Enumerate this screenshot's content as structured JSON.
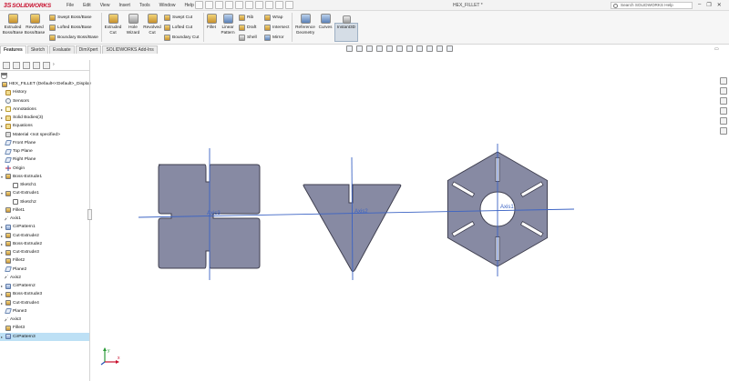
{
  "app": {
    "brand": "SOLIDWORKS",
    "brand_mark": "3S"
  },
  "menu": [
    "File",
    "Edit",
    "View",
    "Insert",
    "Tools",
    "Window",
    "Help"
  ],
  "document_title": "HEX_FILLET *",
  "search_placeholder": "Search SOLIDWORKS Help",
  "window_controls": {
    "minimize": "–",
    "restore": "❐",
    "close": "✕"
  },
  "ribbon": {
    "extruded_boss": "Extruded\nBoss/Base",
    "revolved_boss": "Revolved\nBoss/Base",
    "swept_boss": "Swept Boss/Base",
    "lofted_boss": "Lofted Boss/Base",
    "boundary_boss": "Boundary Boss/Base",
    "extruded_cut": "Extruded\nCut",
    "hole_wizard": "Hole\nWizard",
    "revolved_cut": "Revolved\nCut",
    "swept_cut": "Swept Cut",
    "lofted_cut": "Lofted Cut",
    "boundary_cut": "Boundary Cut",
    "fillet": "Fillet",
    "linear_pattern": "Linear\nPattern",
    "rib": "Rib",
    "draft": "Draft",
    "shell": "Shell",
    "wrap": "Wrap",
    "intersect": "Intersect",
    "mirror": "Mirror",
    "reference_geometry": "Reference\nGeometry",
    "curves": "Curves",
    "instant3d": "Instant3D"
  },
  "tabs": [
    "Features",
    "Sketch",
    "Evaluate",
    "DimXpert",
    "SOLIDWORKS Add-Ins"
  ],
  "tree": {
    "root": "HEX_FILLET  (Default<<Default>_Display",
    "items": [
      {
        "label": "History",
        "icon": "folder-icon",
        "kind": "folder",
        "expand": ""
      },
      {
        "label": "Sensors",
        "icon": "sensor-icon",
        "kind": "sensor",
        "expand": ""
      },
      {
        "label": "Annotations",
        "icon": "annotation-icon",
        "kind": "anno",
        "expand": "▸"
      },
      {
        "label": "Solid Bodies(3)",
        "icon": "folder-icon",
        "kind": "folder",
        "expand": "▸"
      },
      {
        "label": "Equations",
        "icon": "equation-icon",
        "kind": "folder",
        "expand": "▸"
      },
      {
        "label": "Material <not specified>",
        "icon": "material-icon",
        "kind": "material",
        "expand": ""
      },
      {
        "label": "Front Plane",
        "icon": "plane-icon",
        "kind": "plane",
        "expand": ""
      },
      {
        "label": "Top Plane",
        "icon": "plane-icon",
        "kind": "plane",
        "expand": ""
      },
      {
        "label": "Right Plane",
        "icon": "plane-icon",
        "kind": "plane",
        "expand": ""
      },
      {
        "label": "Origin",
        "icon": "origin-icon",
        "kind": "origin",
        "expand": ""
      },
      {
        "label": "Boss-Extrude1",
        "icon": "feature-icon",
        "kind": "feat",
        "expand": "▾"
      },
      {
        "label": "Sketch1",
        "icon": "sketch-icon",
        "kind": "sketch",
        "expand": "",
        "indent": true
      },
      {
        "label": "Cut-Extrude1",
        "icon": "feature-icon",
        "kind": "feat",
        "expand": "▾"
      },
      {
        "label": "Sketch2",
        "icon": "sketch-icon",
        "kind": "sketch",
        "expand": "",
        "indent": true
      },
      {
        "label": "Fillet1",
        "icon": "fillet-icon",
        "kind": "feat",
        "expand": ""
      },
      {
        "label": "Axis1",
        "icon": "axis-icon",
        "kind": "axis",
        "expand": ""
      },
      {
        "label": "CirPattern1",
        "icon": "pattern-icon",
        "kind": "pattern",
        "expand": "▸"
      },
      {
        "label": "Cut-Extrude2",
        "icon": "feature-icon",
        "kind": "feat",
        "expand": "▸"
      },
      {
        "label": "Boss-Extrude2",
        "icon": "feature-icon",
        "kind": "feat",
        "expand": "▸"
      },
      {
        "label": "Cut-Extrude3",
        "icon": "feature-icon",
        "kind": "feat",
        "expand": "▸"
      },
      {
        "label": "Fillet2",
        "icon": "fillet-icon",
        "kind": "feat",
        "expand": ""
      },
      {
        "label": "Plane2",
        "icon": "plane-icon",
        "kind": "plane",
        "expand": ""
      },
      {
        "label": "Axis2",
        "icon": "axis-icon",
        "kind": "axis",
        "expand": ""
      },
      {
        "label": "CirPattern2",
        "icon": "pattern-icon",
        "kind": "pattern",
        "expand": "▸"
      },
      {
        "label": "Boss-Extrude3",
        "icon": "feature-icon",
        "kind": "feat",
        "expand": "▸"
      },
      {
        "label": "Cut-Extrude4",
        "icon": "feature-icon",
        "kind": "feat",
        "expand": "▸"
      },
      {
        "label": "Plane3",
        "icon": "plane-icon",
        "kind": "plane",
        "expand": ""
      },
      {
        "label": "Axis3",
        "icon": "axis-icon",
        "kind": "axis",
        "expand": ""
      },
      {
        "label": "Fillet3",
        "icon": "fillet-icon",
        "kind": "feat",
        "expand": ""
      },
      {
        "label": "CirPattern3",
        "icon": "pattern-icon",
        "kind": "pattern",
        "expand": "▸",
        "selected": true
      }
    ]
  },
  "viewport": {
    "axes": [
      {
        "label": "Axis3"
      },
      {
        "label": "Axis2"
      },
      {
        "label": "Axis1"
      }
    ],
    "part_color": "#878aa3",
    "edge_color": "#3f3f4f",
    "axis_color": "#3b63c4"
  },
  "triad": {
    "x": "x",
    "y": "y"
  }
}
